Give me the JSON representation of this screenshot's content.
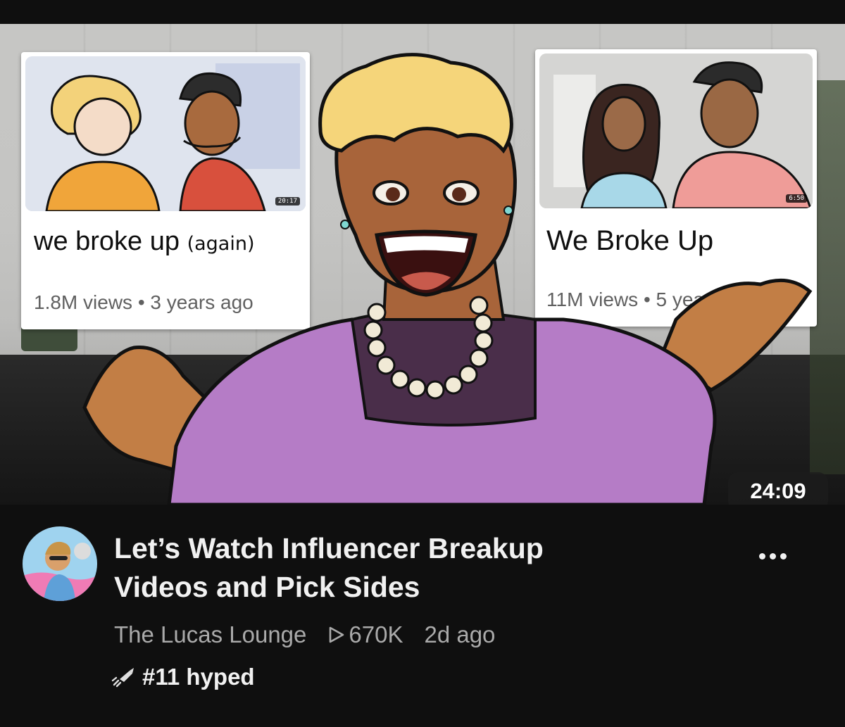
{
  "video": {
    "duration": "24:09",
    "title_line1": "Let’s Watch Influencer Breakup",
    "title_line2": "Videos and Pick Sides",
    "channel": "The Lucas Lounge",
    "views": "670K",
    "uploaded": "2d ago",
    "hype": "#11 hyped"
  },
  "thumbnail_cards": {
    "left": {
      "title_main": "we broke up",
      "title_aside": "(again)",
      "meta": "1.8M views • 3 years ago",
      "duration": "20:17"
    },
    "right": {
      "title": "We Broke Up",
      "meta": "11M views • 5 years ago",
      "duration": "6:50"
    }
  },
  "icons": {
    "more": "more-vert-icon",
    "views": "play-outline-icon",
    "hype": "hype-rocket-icon",
    "avatar": "channel-avatar"
  },
  "colors": {
    "background": "#0f0f0f",
    "title": "#f1f1f1",
    "meta": "#aaaaaa",
    "sweater": "#b57cc6",
    "hair": "#f5d57a",
    "skin": "#a8643a"
  }
}
